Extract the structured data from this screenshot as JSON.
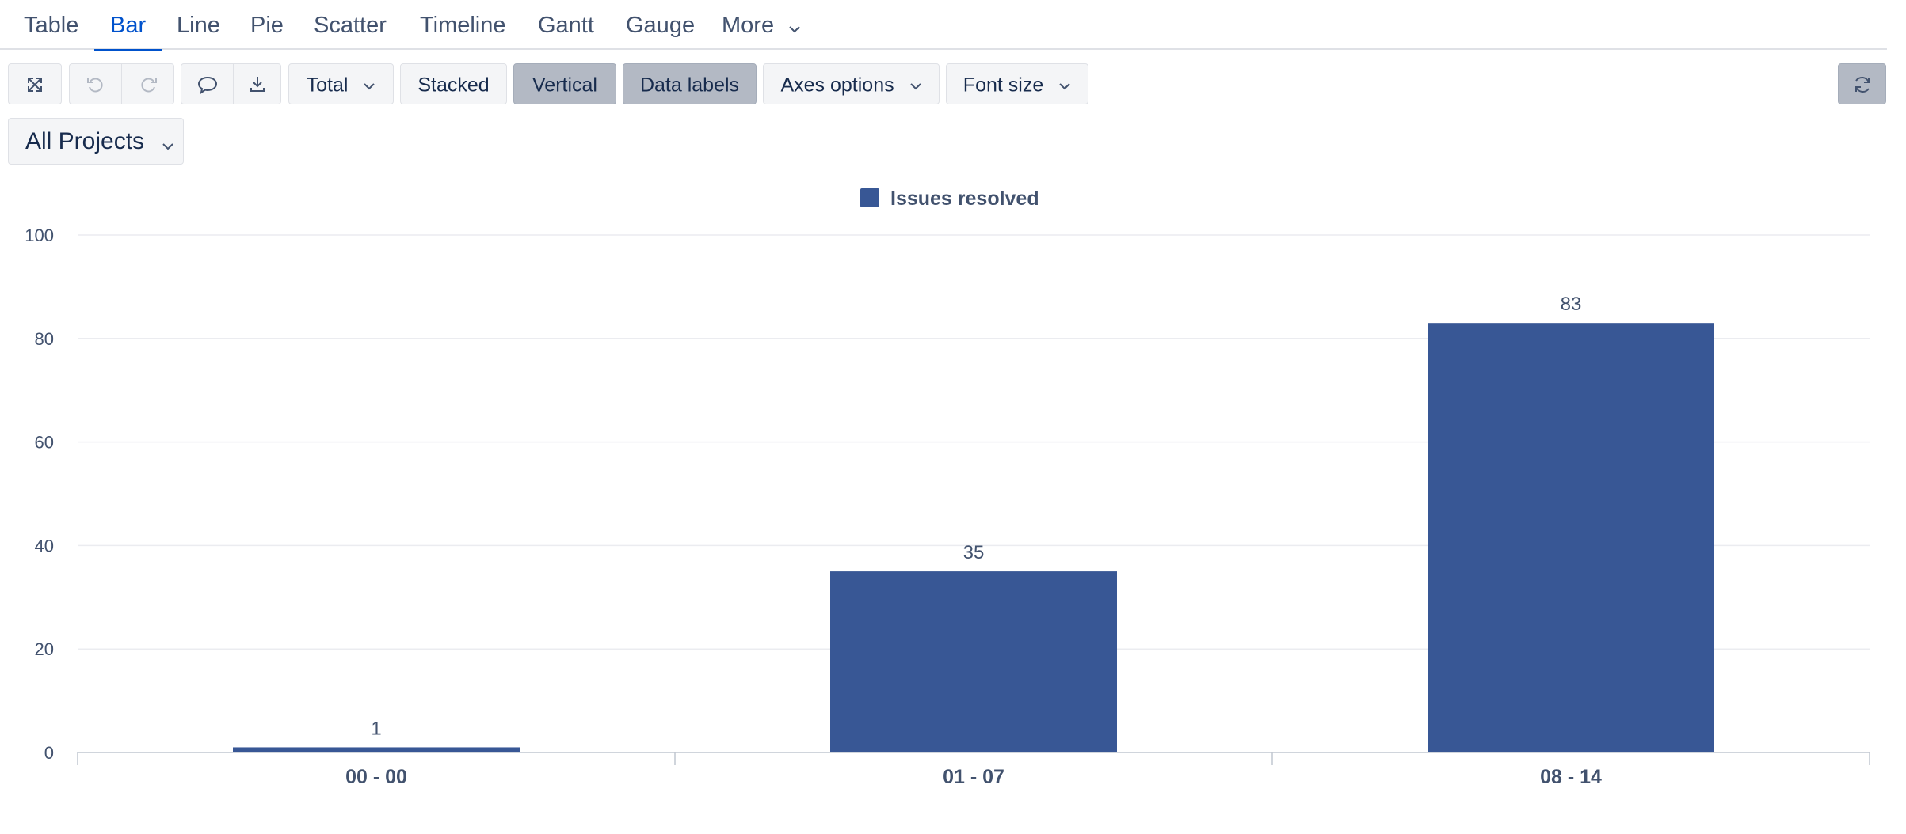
{
  "tabs": [
    {
      "label": "Table",
      "active": false
    },
    {
      "label": "Bar",
      "active": true
    },
    {
      "label": "Line",
      "active": false
    },
    {
      "label": "Pie",
      "active": false
    },
    {
      "label": "Scatter",
      "active": false
    },
    {
      "label": "Timeline",
      "active": false
    },
    {
      "label": "Gantt",
      "active": false
    },
    {
      "label": "Gauge",
      "active": false
    }
  ],
  "more_label": "More",
  "toolbar": {
    "total_label": "Total",
    "stacked_label": "Stacked",
    "vertical_label": "Vertical",
    "data_labels_label": "Data labels",
    "axes_options_label": "Axes options",
    "font_size_label": "Font size"
  },
  "filter": {
    "projects_label": "All Projects"
  },
  "colors": {
    "bar": "#385795",
    "accent": "#0052cc",
    "toggle_on": "#b3b9c4"
  },
  "icons": {
    "fullscreen": "expand-icon",
    "undo": "undo-icon",
    "redo": "redo-icon",
    "comment": "comment-icon",
    "download": "download-icon",
    "refresh": "refresh-icon"
  },
  "chart_data": {
    "type": "bar",
    "categories": [
      "00 - 00",
      "01 - 07",
      "08 - 14"
    ],
    "series": [
      {
        "name": "Issues resolved",
        "values": [
          1,
          35,
          83
        ]
      }
    ],
    "yticks": [
      "0",
      "20",
      "40",
      "60",
      "80",
      "100"
    ],
    "ylim": [
      0,
      100
    ],
    "grid": true,
    "legend": "top-center",
    "data_labels": true
  }
}
